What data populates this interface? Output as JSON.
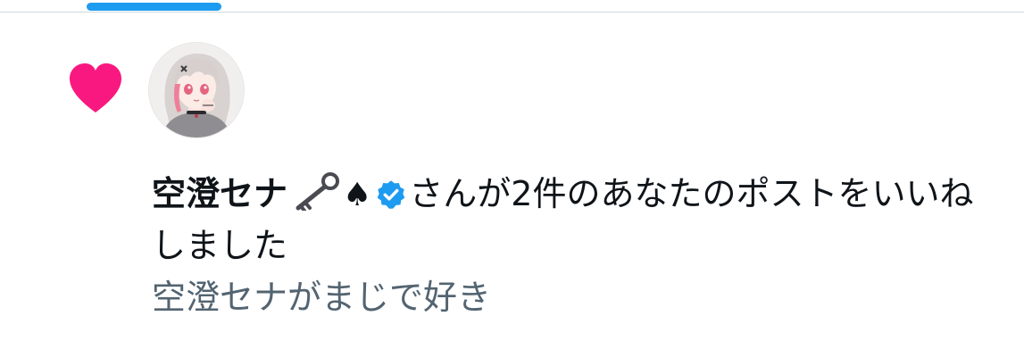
{
  "tabs": {
    "active_indicator_color": "#1d9bf0"
  },
  "notification": {
    "type_icon": "heart-icon",
    "heart_color": "#f91880",
    "avatar_alt": "avatar",
    "user_name": "空澄セナ",
    "name_badges": [
      "key-icon",
      "spade-icon",
      "verified-icon"
    ],
    "spade_glyph": "♠",
    "verified_color": "#1d9bf0",
    "action_text": "さんが2件のあなたのポストをいいねしました",
    "post_preview": "空澄セナがまじで好き"
  }
}
